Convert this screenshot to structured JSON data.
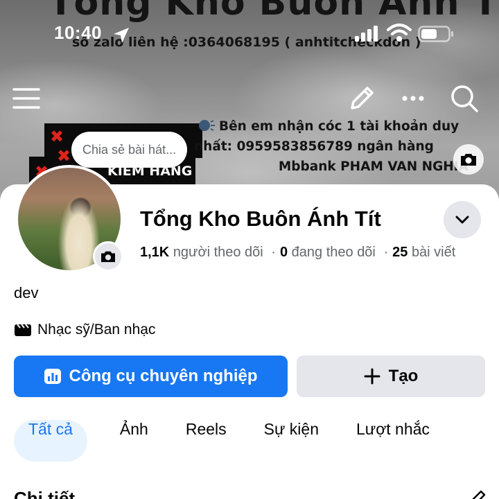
{
  "status_bar": {
    "time": "10:40"
  },
  "cover": {
    "banner_title": "Tổng Kho Buôn Ánh Tít",
    "banner_subline": "số zalo liên hệ :0364068195 ( anhtitcheckdon )",
    "note_line1": "Bên em nhận cóc 1 tài khoản duy",
    "note_line2": "nhất: 0959583856789 ngân hàng",
    "note_line3": "Mbbank PHAM VAN NGHIA",
    "box_text": "KIEM HANG",
    "share_bubble": "Chia sẻ bài hát..."
  },
  "profile": {
    "name": "Tổng Kho Buôn Ánh Tít",
    "followers_count": "1,1K",
    "followers_label": "người theo dõi",
    "following_count": "0",
    "following_label": "đang theo dõi",
    "posts_count": "25",
    "posts_label": "bài viết",
    "separator": "·",
    "bio": "dev",
    "category": "Nhạc sỹ/Ban nhạc"
  },
  "actions": {
    "primary_label": "Công cụ chuyên nghiệp",
    "secondary_label": "Tạo"
  },
  "tabs": [
    {
      "label": "Tất cả",
      "active": true
    },
    {
      "label": "Ảnh",
      "active": false
    },
    {
      "label": "Reels",
      "active": false
    },
    {
      "label": "Sự kiện",
      "active": false
    },
    {
      "label": "Lượt nhắc",
      "active": false
    }
  ],
  "details": {
    "title": "Chi tiết"
  },
  "colors": {
    "accent": "#1877f2",
    "tab_active_bg": "#e7f3ff",
    "secondary_btn_bg": "#e4e6eb",
    "muted_text": "#65676b",
    "cover_x_red": "#e0241a"
  },
  "icons": {
    "menu": "hamburger-menu-icon",
    "edit": "pencil-icon",
    "more": "more-dots-icon",
    "search": "search-icon",
    "camera": "camera-icon",
    "dropdown": "chevron-down-icon",
    "category": "clapperboard-icon",
    "professional_tools": "bar-chart-icon",
    "create": "plus-icon"
  }
}
